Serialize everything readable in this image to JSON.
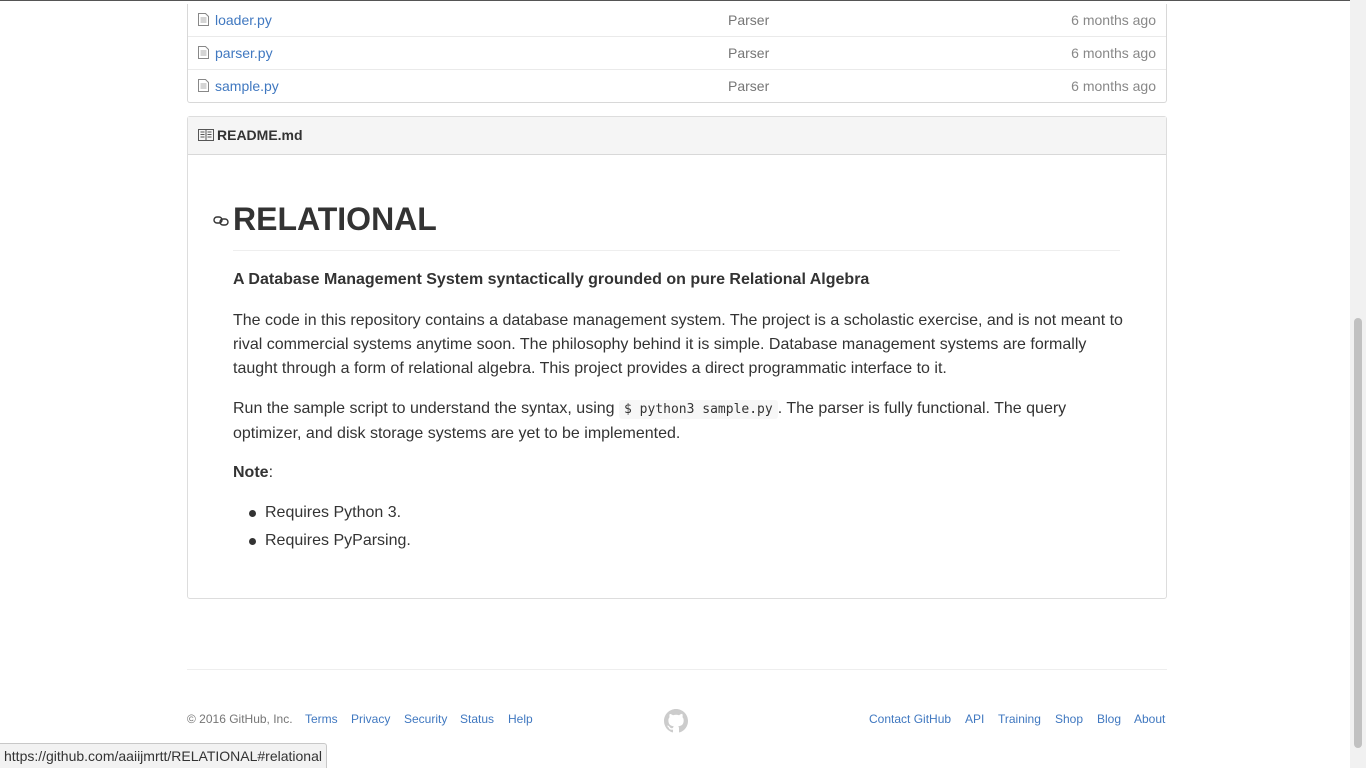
{
  "files": [
    {
      "name": "loader.py",
      "message": "Parser",
      "age": "6 months ago"
    },
    {
      "name": "parser.py",
      "message": "Parser",
      "age": "6 months ago"
    },
    {
      "name": "sample.py",
      "message": "Parser",
      "age": "6 months ago"
    }
  ],
  "readme": {
    "filename": "README.md",
    "title": "RELATIONAL",
    "subtitle": "A Database Management System syntactically grounded on pure Relational Algebra",
    "para1": "The code in this repository contains a database management system. The project is a scholastic exercise, and is not meant to rival commercial systems anytime soon. The philosophy behind it is simple. Database management systems are formally taught through a form of relational algebra. This project provides a direct programmatic interface to it.",
    "para2_before": "Run the sample script to understand the syntax, using ",
    "para2_code": "$ python3 sample.py",
    "para2_after": ". The parser is fully functional. The query optimizer, and disk storage systems are yet to be implemented.",
    "note_label": "Note",
    "note_suffix": ":",
    "requirements": [
      "Requires Python 3.",
      "Requires PyParsing."
    ]
  },
  "footer": {
    "copyright": "© 2016 GitHub, Inc.",
    "left_links": [
      "Terms",
      "Privacy",
      "Security",
      "Status",
      "Help"
    ],
    "right_links": [
      "Contact GitHub",
      "API",
      "Training",
      "Shop",
      "Blog",
      "About"
    ]
  },
  "status_url": "https://github.com/aaiijmrtt/RELATIONAL#relational",
  "colors": {
    "link": "#4078c0",
    "text": "#333333",
    "muted": "#767676"
  }
}
